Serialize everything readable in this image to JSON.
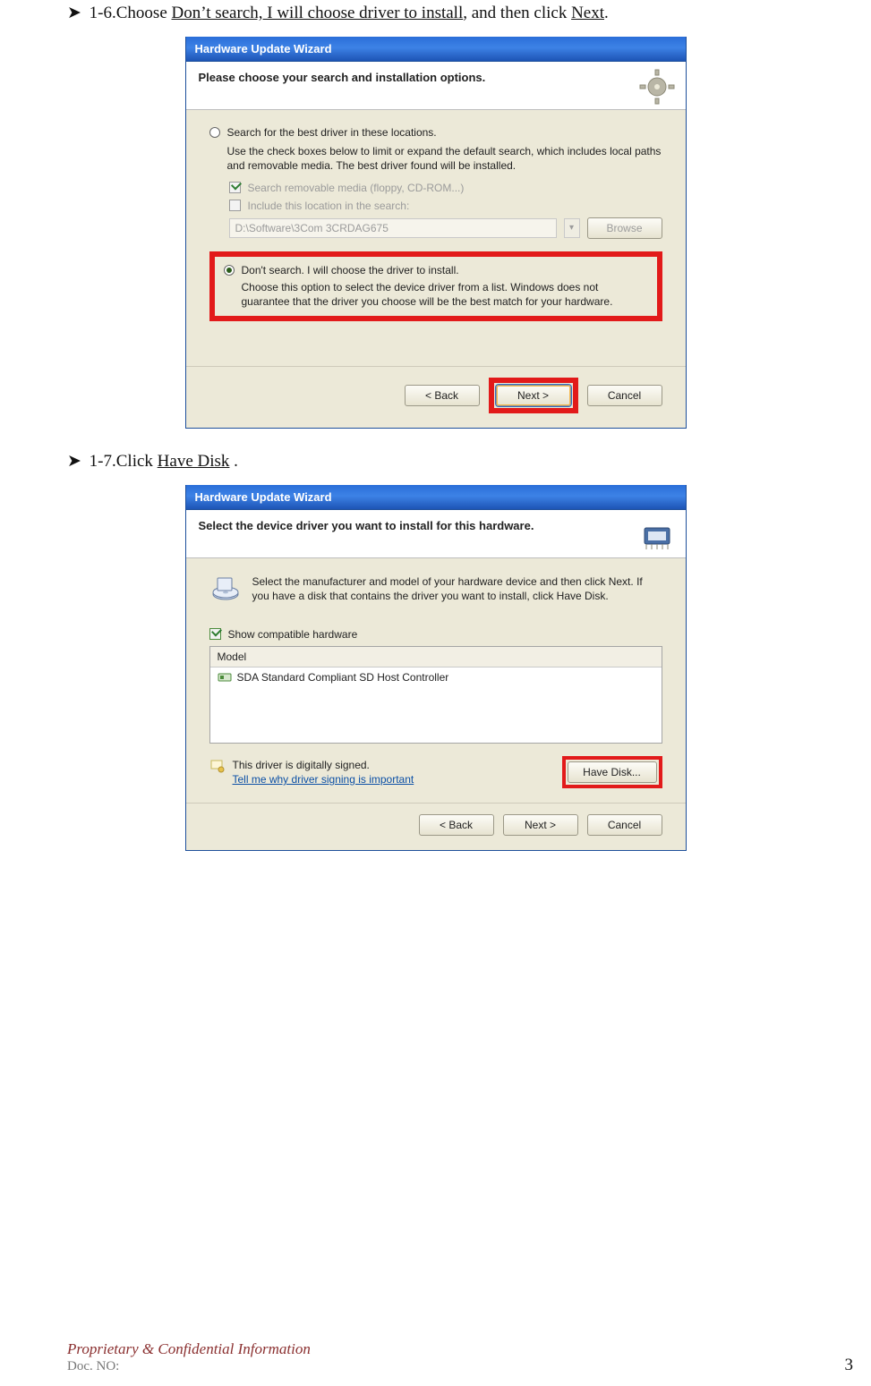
{
  "steps": {
    "s1_6": {
      "prefix": "1-6.Choose ",
      "option_underlined": "Don’t search, I will choose driver to install",
      "mid": ", and then click ",
      "next_underlined": "Next",
      "tail": "."
    },
    "s1_7": {
      "prefix": "1-7.Click ",
      "link_underlined": "Have Disk",
      "tail": " ."
    }
  },
  "wizard1": {
    "title": "Hardware Update Wizard",
    "heading": "Please choose your search and installation options.",
    "opt1_label": "Search for the best driver in these locations.",
    "opt1_desc": "Use the check boxes below to limit or expand the default search, which includes local paths and removable media. The best driver found will be installed.",
    "chk_removable": "Search removable media (floppy, CD-ROM...)",
    "chk_include": "Include this location in the search:",
    "path_value": "D:\\Software\\3Com 3CRDAG675",
    "browse": "Browse",
    "opt2_label": "Don't search. I will choose the driver to install.",
    "opt2_desc": "Choose this option to select the device driver from a list.  Windows does not guarantee that the driver you choose will be the best match for your hardware.",
    "btn_back": "< Back",
    "btn_next": "Next >",
    "btn_cancel": "Cancel"
  },
  "wizard2": {
    "title": "Hardware Update Wizard",
    "heading": "Select the device driver you want to install for this hardware.",
    "intro": "Select the manufacturer and model of your hardware device and then click Next. If you have a disk that contains the driver you want to install, click Have Disk.",
    "show_compat": "Show compatible hardware",
    "model_header": "Model",
    "model_item": "SDA Standard Compliant SD Host Controller",
    "signed": "This driver is digitally signed.",
    "signed_link": "Tell me why driver signing is important",
    "btn_havedisk": "Have Disk...",
    "btn_back": "< Back",
    "btn_next": "Next >",
    "btn_cancel": "Cancel"
  },
  "footer": {
    "confidential": "Proprietary & Confidential Information",
    "doc_no": "Doc. NO:",
    "page": "3"
  }
}
